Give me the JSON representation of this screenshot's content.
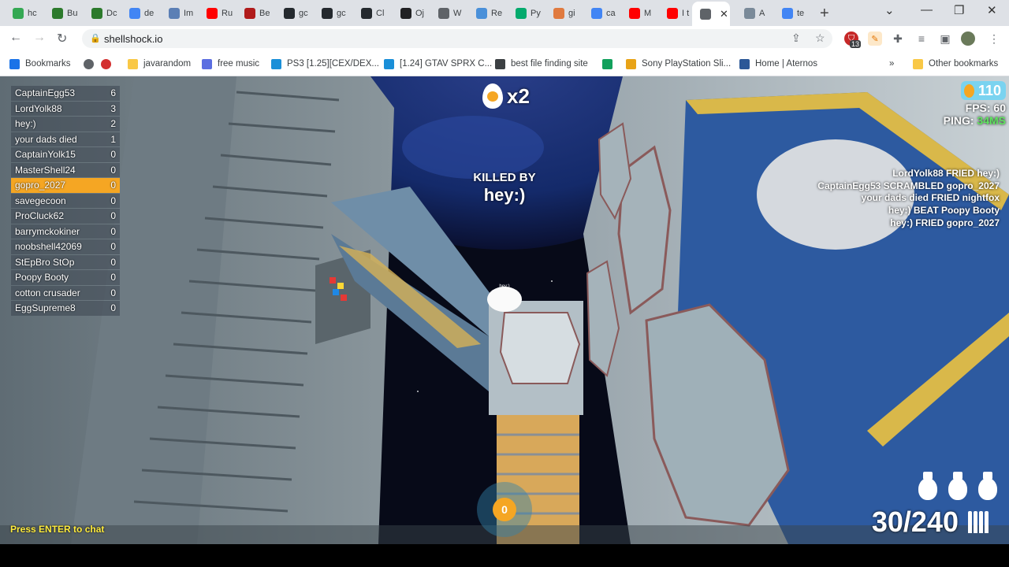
{
  "browser": {
    "tabs": [
      {
        "label": "hc",
        "icon": "colored-logo-icon",
        "color": "#34a853"
      },
      {
        "label": "Bu",
        "icon": "pixel-logo-icon",
        "color": "#2c7a2c"
      },
      {
        "label": "Dc",
        "icon": "pixel-logo-icon",
        "color": "#2c7a2c"
      },
      {
        "label": "de",
        "icon": "google-icon",
        "color": "#4285f4"
      },
      {
        "label": "Im",
        "icon": "chart-icon",
        "color": "#5b7fb5"
      },
      {
        "label": "Ru",
        "icon": "youtube-icon",
        "color": "#ff0000"
      },
      {
        "label": "Be",
        "icon": "gmail-icon",
        "color": "#b01b1b"
      },
      {
        "label": "gc",
        "icon": "github-icon",
        "color": "#24292e"
      },
      {
        "label": "gc",
        "icon": "github-icon",
        "color": "#24292e"
      },
      {
        "label": "Cl",
        "icon": "github-icon",
        "color": "#24292e"
      },
      {
        "label": "Oj",
        "icon": "openai-icon",
        "color": "#202123"
      },
      {
        "label": "W",
        "icon": "globe-icon",
        "color": "#5f6368"
      },
      {
        "label": "Re",
        "icon": "dot-icon",
        "color": "#4a90d9"
      },
      {
        "label": "Py",
        "icon": "w3-icon",
        "color": "#04aa6d"
      },
      {
        "label": "gi",
        "icon": "hand-icon",
        "color": "#e07a3f"
      },
      {
        "label": "ca",
        "icon": "google-icon",
        "color": "#4285f4"
      },
      {
        "label": "M",
        "icon": "youtube-icon",
        "color": "#ff0000"
      },
      {
        "label": "I t",
        "icon": "youtube-icon",
        "color": "#ff0000"
      },
      {
        "label": "",
        "icon": "speaker-icon",
        "color": "#5f6368",
        "active": true
      },
      {
        "label": "A",
        "icon": "image-icon",
        "color": "#7a8a99"
      },
      {
        "label": "te",
        "icon": "google-icon",
        "color": "#4285f4"
      }
    ],
    "new_tab": "+",
    "url": "shellshock.io",
    "extension_badge": "13",
    "bookmarks": [
      {
        "label": "Bookmarks",
        "icon": "star-icon",
        "color": "#1a73e8"
      },
      {
        "label": "",
        "icon": "globe-icon",
        "color": "#5f6368"
      },
      {
        "label": "",
        "icon": "heart-icon",
        "color": "#d32f2f"
      },
      {
        "label": "javarandom",
        "icon": "folder-icon",
        "color": "#f9c846"
      },
      {
        "label": "free music",
        "icon": "music-icon",
        "color": "#5b6ee1"
      },
      {
        "label": "PS3 [1.25][CEX/DEX...",
        "icon": "c-icon",
        "color": "#1a8fd8"
      },
      {
        "label": "[1.24] GTAV SPRX C...",
        "icon": "c-icon",
        "color": "#1a8fd8"
      },
      {
        "label": "best file finding site",
        "icon": "briefcase-icon",
        "color": "#3c4043"
      },
      {
        "label": "",
        "icon": "app-icon",
        "color": "#12a05c"
      },
      {
        "label": "Sony PlayStation Sli...",
        "icon": "bag-icon",
        "color": "#e8a317"
      },
      {
        "label": "Home | Aternos",
        "icon": "grid-icon",
        "color": "#2b5797"
      },
      {
        "label": "Other bookmarks",
        "icon": "folder-icon",
        "color": "#f9c846"
      }
    ],
    "more_bookmarks": "»"
  },
  "game": {
    "leaderboard": [
      {
        "name": "CaptainEgg53",
        "score": "6"
      },
      {
        "name": "LordYolk88",
        "score": "3"
      },
      {
        "name": "hey:)",
        "score": "2"
      },
      {
        "name": "your dads died",
        "score": "1"
      },
      {
        "name": "CaptainYolk15",
        "score": "0"
      },
      {
        "name": "MasterShell24",
        "score": "0"
      },
      {
        "name": "gopro_2027",
        "score": "0",
        "me": true
      },
      {
        "name": "savegecoon",
        "score": "0"
      },
      {
        "name": "ProCluck62",
        "score": "0"
      },
      {
        "name": "barrymckokiner",
        "score": "0"
      },
      {
        "name": "noobshell42069",
        "score": "0"
      },
      {
        "name": "StEpBro StOp",
        "score": "0"
      },
      {
        "name": "Poopy Booty",
        "score": "0"
      },
      {
        "name": "cotton crusader",
        "score": "0"
      },
      {
        "name": "EggSupreme8",
        "score": "0"
      }
    ],
    "kill_multiplier": "x2",
    "killed_by_label": "KILLED BY",
    "killer": "hey:)",
    "player_tag": "hey:)",
    "eggs": "110",
    "fps_label": "FPS:",
    "fps": "60",
    "ping_label": "PING:",
    "ping": "34MS",
    "killfeed": [
      "LordYolk88 FRIED hey:)",
      "CaptainEgg53 SCRAMBLED gopro_2027",
      "your dads died FRIED nightfox",
      "hey:) BEAT Poopy Booty",
      "hey:) FRIED gopro_2027"
    ],
    "grenade_count": 3,
    "ammo": "30/240",
    "score": "0",
    "chat_hint": "Press ENTER to chat"
  }
}
